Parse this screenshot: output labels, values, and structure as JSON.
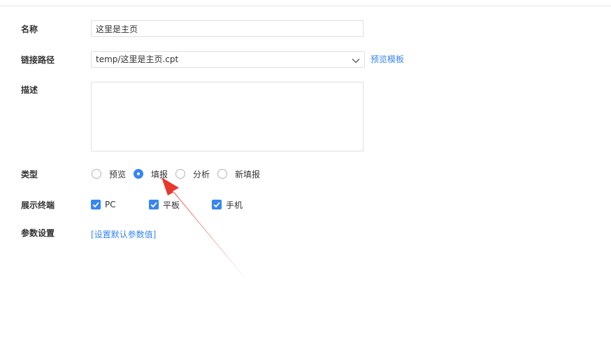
{
  "form": {
    "name": {
      "label": "名称",
      "value": "这里是主页"
    },
    "link_path": {
      "label": "链接路径",
      "value": "temp/这里是主页.cpt",
      "preview_link": "预览模板"
    },
    "description": {
      "label": "描述",
      "value": ""
    },
    "type": {
      "label": "类型",
      "options": [
        "预览",
        "填报",
        "分析",
        "新填报"
      ],
      "selected": "填报"
    },
    "terminals": {
      "label": "展示终端",
      "options": [
        {
          "label": "PC",
          "checked": true
        },
        {
          "label": "平板",
          "checked": true
        },
        {
          "label": "手机",
          "checked": true
        }
      ]
    },
    "params": {
      "label": "参数设置",
      "link": "[设置默认参数值]"
    }
  },
  "colors": {
    "accent": "#3685f2",
    "annotation": "#e8372c",
    "border": "#dcdfe6"
  },
  "icons": {
    "select_arrow": "chevron-down-icon",
    "check": "check-icon",
    "annotation": "red-arrow-icon"
  }
}
